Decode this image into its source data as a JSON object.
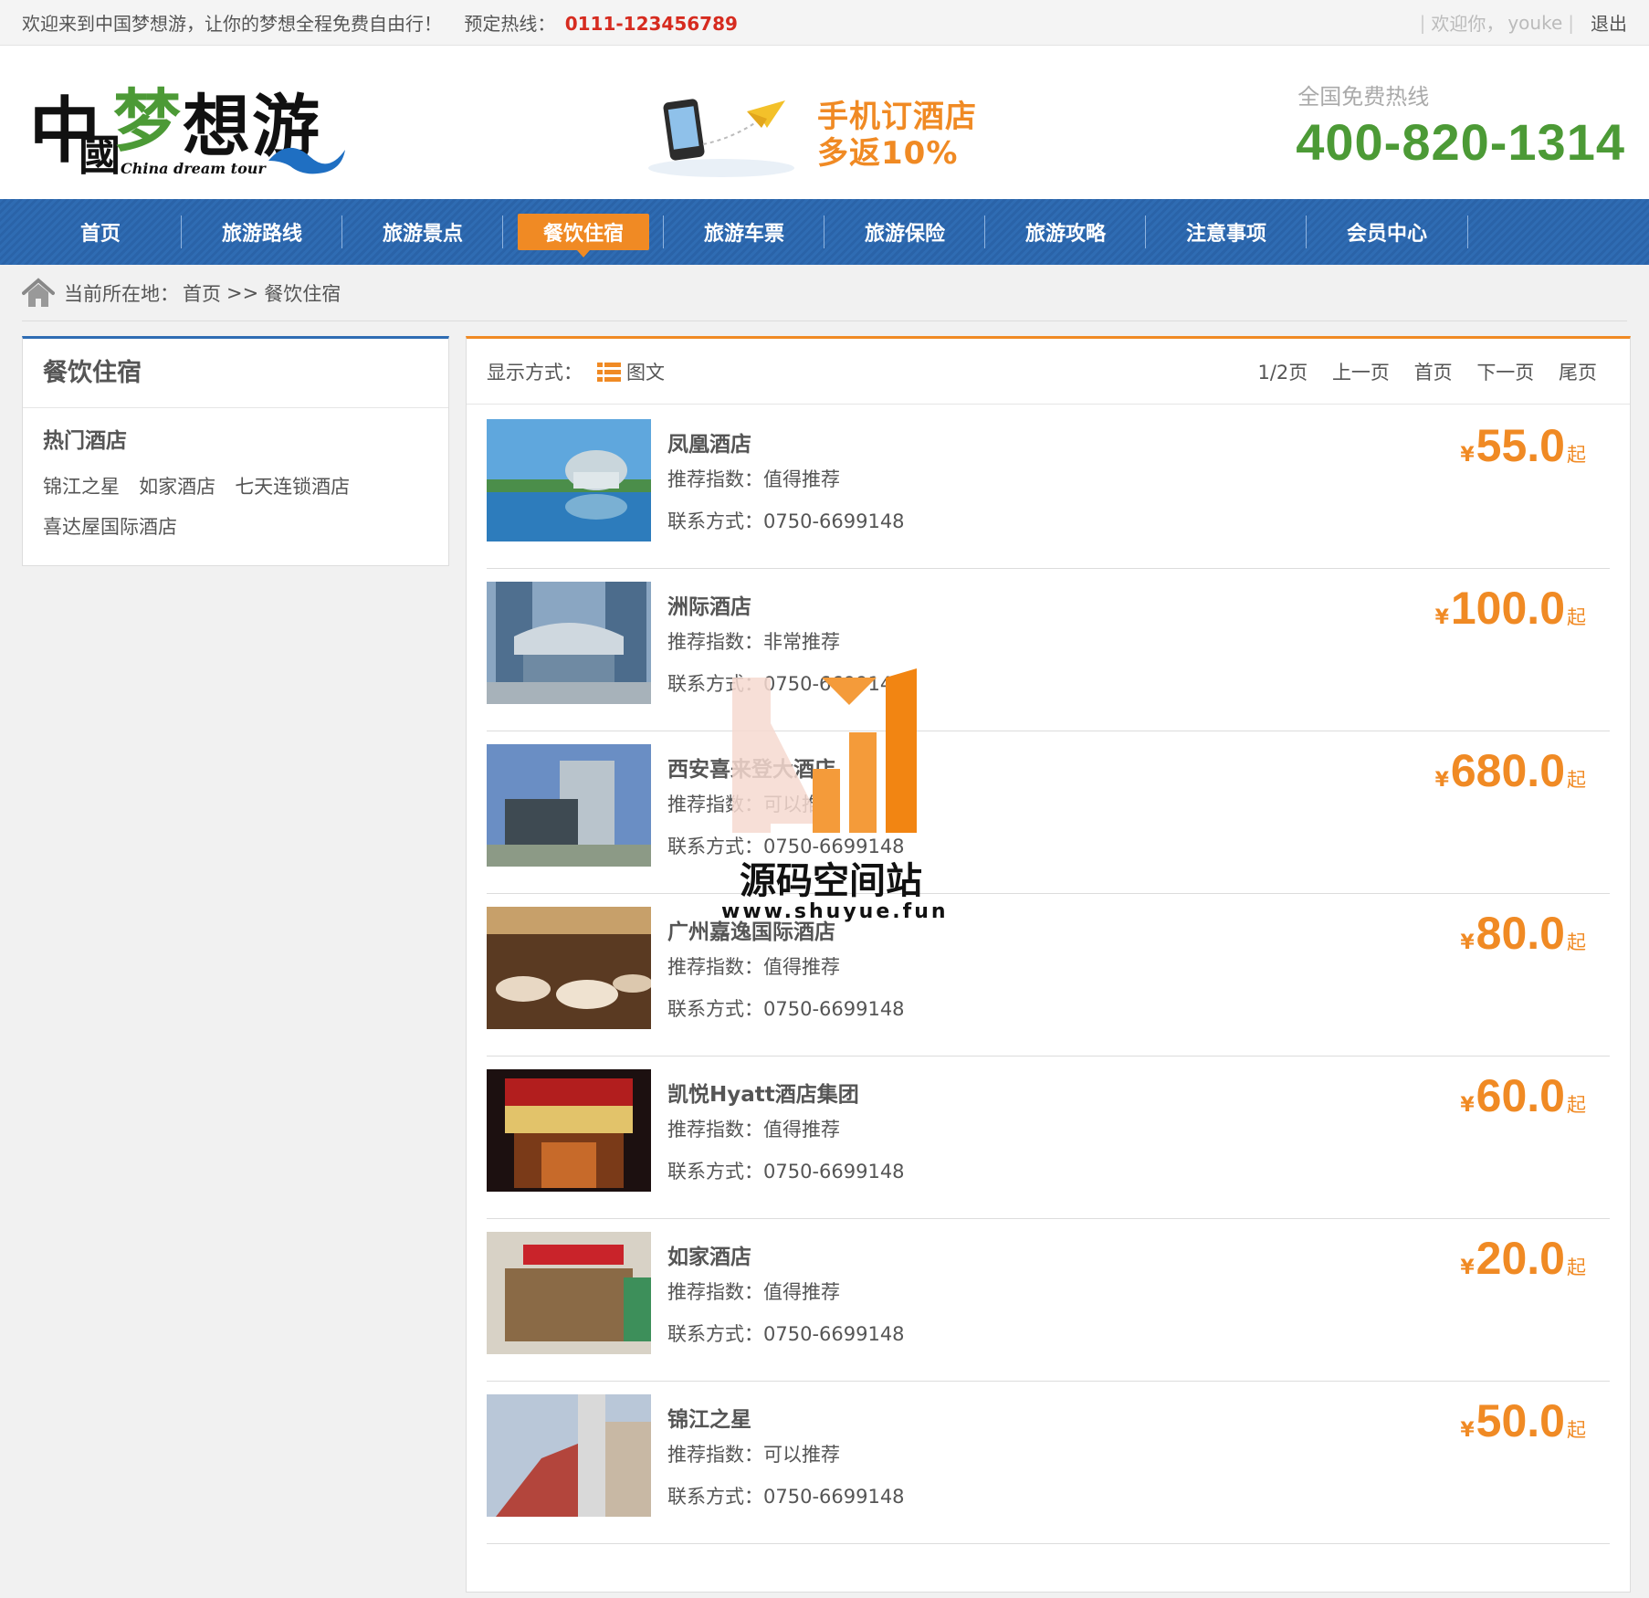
{
  "topbar": {
    "welcome": "欢迎来到中国梦想游，让你的梦想全程免费自由行！",
    "hotline_label": "预定热线：",
    "hotline_number": "0111-123456789",
    "greeting": "欢迎你，",
    "username": "youke",
    "logout": "退出"
  },
  "header": {
    "logo_alt": "中国梦想游 China dream tour",
    "promo_line1": "手机订酒店",
    "promo_line2": "多返10%",
    "free_label": "全国免费热线",
    "free_number": "400-820-1314"
  },
  "nav": {
    "items": [
      {
        "label": "首页"
      },
      {
        "label": "旅游路线"
      },
      {
        "label": "旅游景点"
      },
      {
        "label": "餐饮住宿"
      },
      {
        "label": "旅游车票"
      },
      {
        "label": "旅游保险"
      },
      {
        "label": "旅游攻略"
      },
      {
        "label": "注意事项"
      },
      {
        "label": "会员中心"
      }
    ],
    "active": "餐饮住宿"
  },
  "breadcrumb": {
    "prefix": "当前所在地：",
    "home": "首页",
    "sep": ">>",
    "current": "餐饮住宿"
  },
  "sidebar": {
    "title": "餐饮住宿",
    "subtitle": "热门酒店",
    "links": [
      {
        "label": "锦江之星"
      },
      {
        "label": "如家酒店"
      },
      {
        "label": "七天连锁酒店"
      },
      {
        "label": "喜达屋国际酒店"
      }
    ]
  },
  "main": {
    "display_label": "显示方式：",
    "display_mode": "图文",
    "pager": {
      "info": "1/2页",
      "prev": "上一页",
      "first": "首页",
      "next": "下一页",
      "last": "尾页"
    },
    "rec_label": "推荐指数：",
    "contact_label": "联系方式：",
    "yen": "¥",
    "qi": "起",
    "hotels": [
      {
        "name": "凤凰酒店",
        "rec": "值得推荐",
        "contact": "0750-6699148",
        "price": "55.0"
      },
      {
        "name": "洲际酒店",
        "rec": "非常推荐",
        "contact": "0750-6699148",
        "price": "100.0"
      },
      {
        "name": "西安喜来登大酒店",
        "rec": "可以推荐",
        "contact": "0750-6699148",
        "price": "680.0"
      },
      {
        "name": "广州嘉逸国际酒店",
        "rec": "值得推荐",
        "contact": "0750-6699148",
        "price": "80.0"
      },
      {
        "name": "凯悦Hyatt酒店集团",
        "rec": "值得推荐",
        "contact": "0750-6699148",
        "price": "60.0"
      },
      {
        "name": "如家酒店",
        "rec": "值得推荐",
        "contact": "0750-6699148",
        "price": "20.0"
      },
      {
        "name": "锦江之星",
        "rec": "可以推荐",
        "contact": "0750-6699148",
        "price": "50.0"
      }
    ]
  },
  "watermark": {
    "name": "源码空间站",
    "url": "www.shuyue.fun"
  },
  "colors": {
    "nav_blue": "#2f6cb3",
    "accent_orange": "#f08a24",
    "hotline_red": "#d62b1f",
    "free_green": "#4c9a36"
  }
}
